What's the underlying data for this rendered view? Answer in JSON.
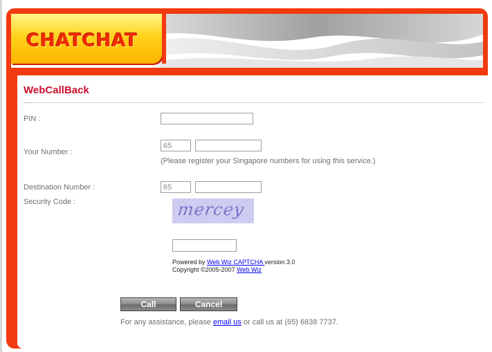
{
  "brand": {
    "logo_text": "CHATCHAT",
    "accent": "#f23a10",
    "title_color": "#c8102e"
  },
  "form": {
    "title": "WebCallBack",
    "pin": {
      "label": "PIN :",
      "value": ""
    },
    "your_number": {
      "label": "Your Number :",
      "country_code": "65",
      "value": "",
      "note": "(Please register your Singapore numbers for using this service.)"
    },
    "destination_number": {
      "label": "Destination Number :",
      "country_code": "65",
      "value": ""
    },
    "security_code": {
      "label": "Security Code :",
      "captcha_text": "mercey",
      "value": ""
    },
    "captcha_credit": {
      "powered_prefix": "Powered by ",
      "powered_link": "Web Wiz CAPTCHA ",
      "powered_suffix": "version 3.0",
      "copyright_prefix": "Copyright ©2005-2007 ",
      "copyright_link": "Web Wiz"
    },
    "buttons": {
      "call": "Call",
      "cancel": "Cancel"
    }
  },
  "footer": {
    "assist_prefix": "For any assistance, please ",
    "assist_link": "email us",
    "assist_suffix": " or call us at (65) 6838 7737."
  }
}
